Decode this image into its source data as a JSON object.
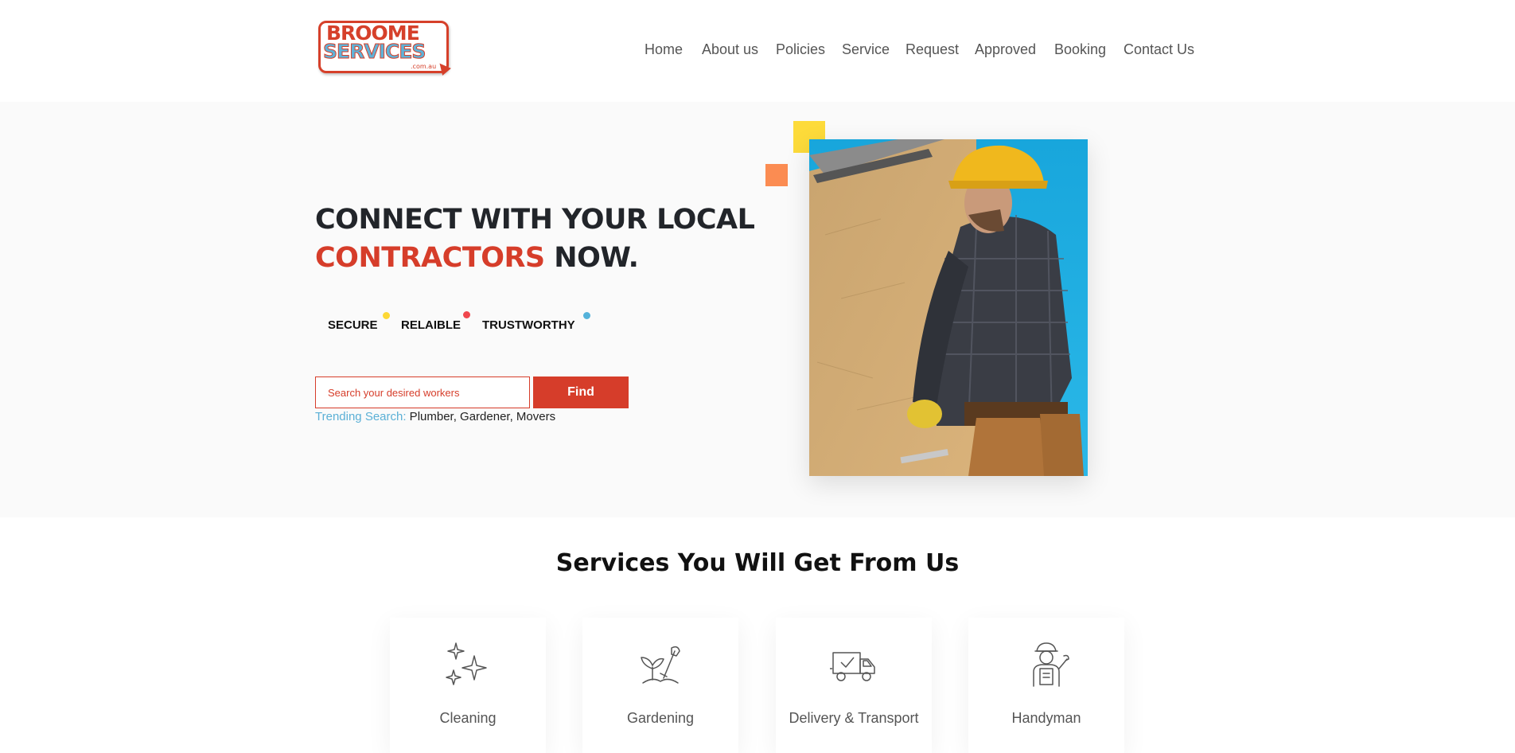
{
  "header": {
    "logo": {
      "line1": "BROOME",
      "line2": "SERVICES",
      "sub": ".com.au"
    },
    "nav": [
      "Home",
      "About us",
      "Policies",
      "Service",
      "Request",
      "Approved",
      "Booking",
      "Contact Us"
    ]
  },
  "hero": {
    "title_line1": "CONNECT WITH YOUR LOCAL",
    "title_accent": "CONTRACTORS",
    "title_rest": " NOW.",
    "features": [
      {
        "label": "SECURE",
        "dot_color": "#fdd835"
      },
      {
        "label": "RELAIBLE",
        "dot_color": "#f0474d"
      },
      {
        "label": "TRUSTWORTHY",
        "dot_color": "#54b2da"
      }
    ],
    "search": {
      "placeholder": "Search your desired workers",
      "button": "Find"
    },
    "trending_label": "Trending Search:",
    "trending_values": " Plumber, Gardener, Movers"
  },
  "services": {
    "title": "Services You Will Get From Us",
    "items": [
      {
        "label": "Cleaning",
        "icon": "sparkles-icon"
      },
      {
        "label": "Gardening",
        "icon": "gardening-icon"
      },
      {
        "label": "Delivery & Transport",
        "icon": "delivery-truck-icon"
      },
      {
        "label": "Handyman",
        "icon": "handyman-icon"
      }
    ]
  },
  "colors": {
    "accent": "#d63d2a",
    "secondary": "#5bb0d6",
    "yellow": "#fddb3a",
    "orange": "#fb8c52"
  }
}
